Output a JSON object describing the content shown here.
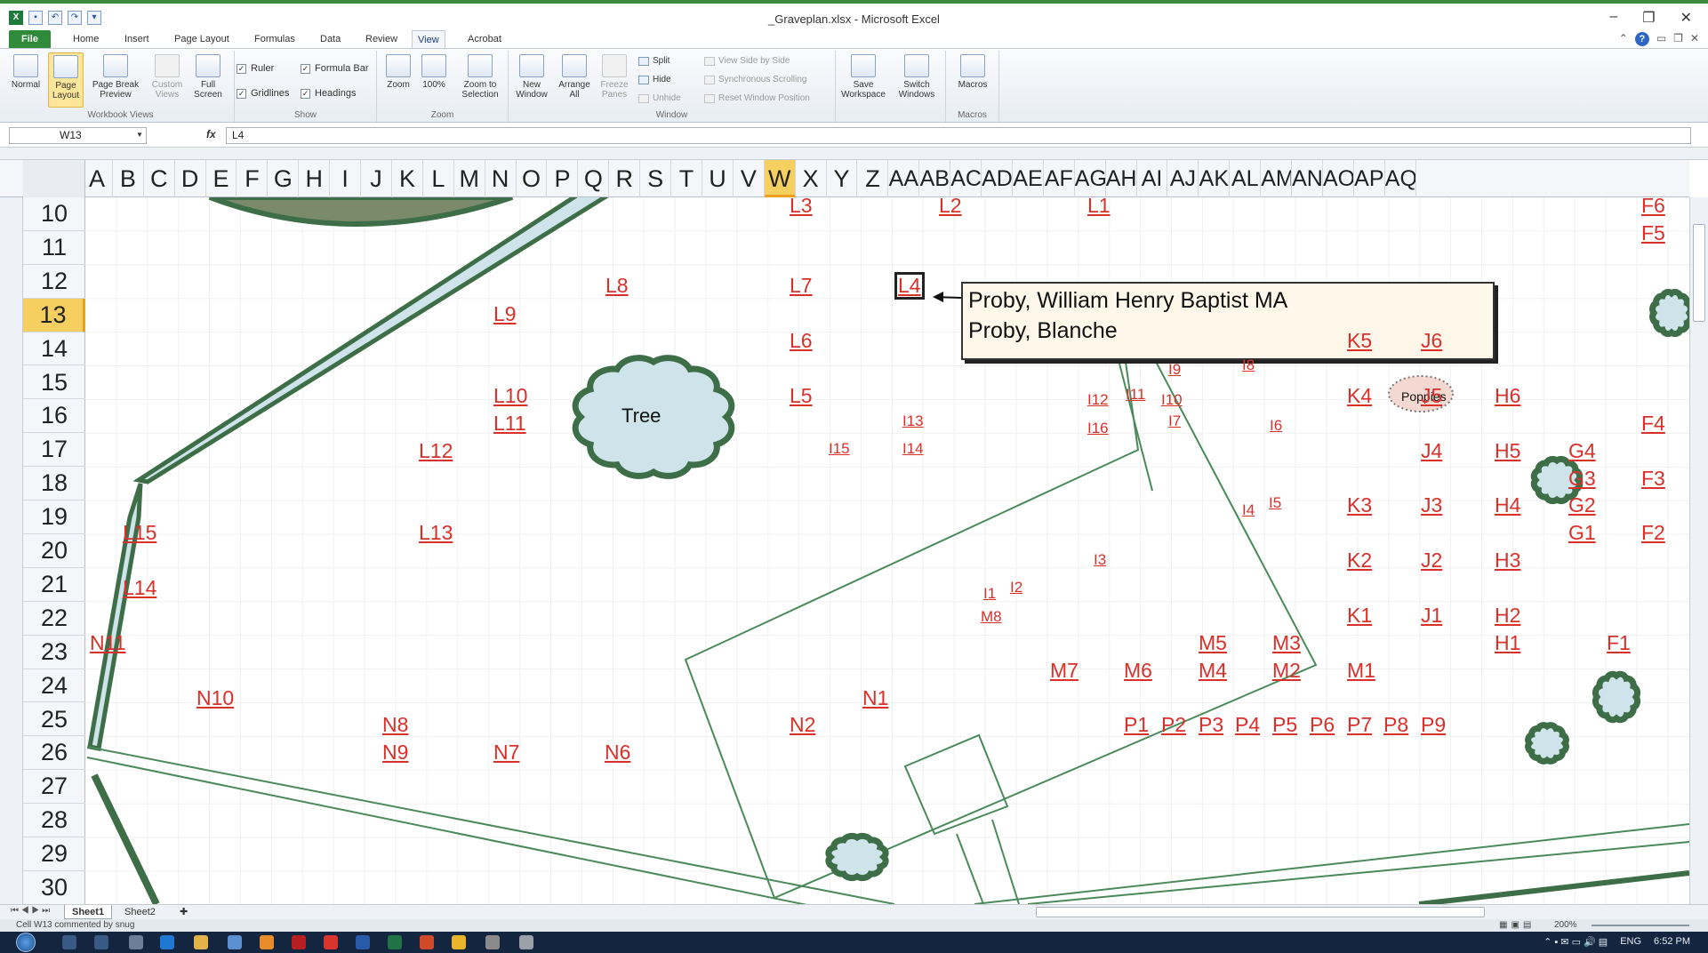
{
  "window": {
    "title": "_Graveplan.xlsx - Microsoft Excel",
    "min": "–",
    "restore": "❐",
    "close": "✕"
  },
  "tabs": [
    "File",
    "Home",
    "Insert",
    "Page Layout",
    "Formulas",
    "Data",
    "Review",
    "View",
    "Acrobat"
  ],
  "active_tab": "View",
  "ribbon": {
    "workbook_views": {
      "caption": "Workbook Views",
      "buttons": [
        "Normal",
        "Page Layout",
        "Page Break Preview",
        "Custom Views",
        "Full Screen"
      ]
    },
    "show": {
      "caption": "Show",
      "checkboxes": [
        {
          "label": "Ruler",
          "checked": true
        },
        {
          "label": "Formula Bar",
          "checked": true
        },
        {
          "label": "Gridlines",
          "checked": true
        },
        {
          "label": "Headings",
          "checked": true
        }
      ]
    },
    "zoom": {
      "caption": "Zoom",
      "buttons": [
        "Zoom",
        "100%",
        "Zoom to Selection"
      ]
    },
    "window": {
      "caption": "Window",
      "buttons": [
        "New Window",
        "Arrange All",
        "Freeze Panes"
      ],
      "small": [
        "Split",
        "Hide",
        "Unhide",
        "View Side by Side",
        "Synchronous Scrolling",
        "Reset Window Position"
      ],
      "save_workspace": "Save Workspace",
      "switch_windows": "Switch Windows"
    },
    "macros": {
      "caption": "Macros",
      "button": "Macros"
    }
  },
  "formula_bar": {
    "name_box": "W13",
    "fx": "fx",
    "formula": "L4"
  },
  "columns": [
    "A",
    "B",
    "C",
    "D",
    "E",
    "F",
    "G",
    "H",
    "I",
    "J",
    "K",
    "L",
    "M",
    "N",
    "O",
    "P",
    "Q",
    "R",
    "S",
    "T",
    "U",
    "V",
    "W",
    "X",
    "Y",
    "Z",
    "AA",
    "AB",
    "AC",
    "AD",
    "AE",
    "AF",
    "AG",
    "AH",
    "AI",
    "AJ",
    "AK",
    "AL",
    "AM",
    "AN",
    "AO",
    "AP",
    "AQ"
  ],
  "selected_column": "W",
  "rows": [
    "10",
    "11",
    "12",
    "13",
    "14",
    "15",
    "16",
    "17",
    "18",
    "19",
    "20",
    "21",
    "22",
    "23",
    "24",
    "25",
    "26",
    "27",
    "28",
    "29",
    "30"
  ],
  "selected_row": "13",
  "comment": {
    "line1": "Proby, William Henry Baptist MA",
    "line2": "Proby, Blanche"
  },
  "shapes": {
    "tree": "Tree",
    "poppies": "Poppies"
  },
  "plots": {
    "L": [
      "L3",
      "L2",
      "L1",
      "L8",
      "L7",
      "L4",
      "L9",
      "L6",
      "L5",
      "L10",
      "L11",
      "L12",
      "L13",
      "L14",
      "L15"
    ],
    "F": [
      "F6",
      "F5",
      "F4",
      "F3",
      "F2",
      "F1"
    ],
    "K": [
      "K5",
      "K4",
      "K3",
      "K2",
      "K1"
    ],
    "J": [
      "J6",
      "J5",
      "J4",
      "J3",
      "J2",
      "J1"
    ],
    "H": [
      "H6",
      "H5",
      "H4",
      "H3",
      "H2",
      "H1"
    ],
    "G": [
      "G4",
      "G3",
      "G2",
      "G1"
    ],
    "I": [
      "I9",
      "I8",
      "I11",
      "I12",
      "I10",
      "I7",
      "I6",
      "I16",
      "I13",
      "I14",
      "I15",
      "I4",
      "I5",
      "I3",
      "I1",
      "I2"
    ],
    "M": [
      "M8",
      "M5",
      "M3",
      "M7",
      "M6",
      "M4",
      "M2",
      "M1"
    ],
    "N": [
      "N11",
      "N10",
      "N1",
      "N2",
      "N8",
      "N9",
      "N7",
      "N6"
    ],
    "P": [
      "P1",
      "P2",
      "P3",
      "P4",
      "P5",
      "P6",
      "P7",
      "P8",
      "P9"
    ]
  },
  "sheets": [
    "Sheet1",
    "Sheet2"
  ],
  "active_sheet": "Sheet1",
  "status": {
    "text": "Cell W13 commented by snug",
    "zoom": "200%"
  },
  "tray": {
    "lang": "ENG",
    "time": "6:52 PM"
  },
  "colors": {
    "accent": "#2f8a3a",
    "plot_label": "#d9302a",
    "path_green": "#4a8a5a",
    "bush_fill": "#cfe3ea",
    "bush_stroke": "#3d6e48"
  }
}
